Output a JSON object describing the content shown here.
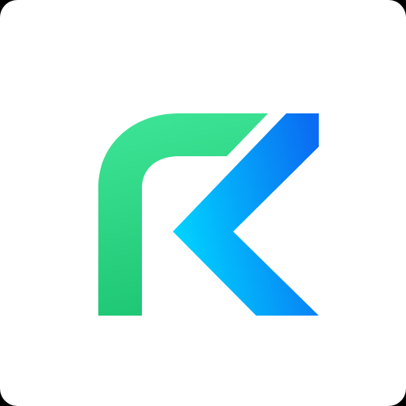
{
  "icon": {
    "name": "rk-logo-icon",
    "background_color": "#ffffff",
    "corner_color": "#000000",
    "colors": {
      "green_light": "#3ee597",
      "green_dark": "#1fc874",
      "blue_light": "#00d2ff",
      "blue_dark": "#0a6cf2"
    }
  }
}
